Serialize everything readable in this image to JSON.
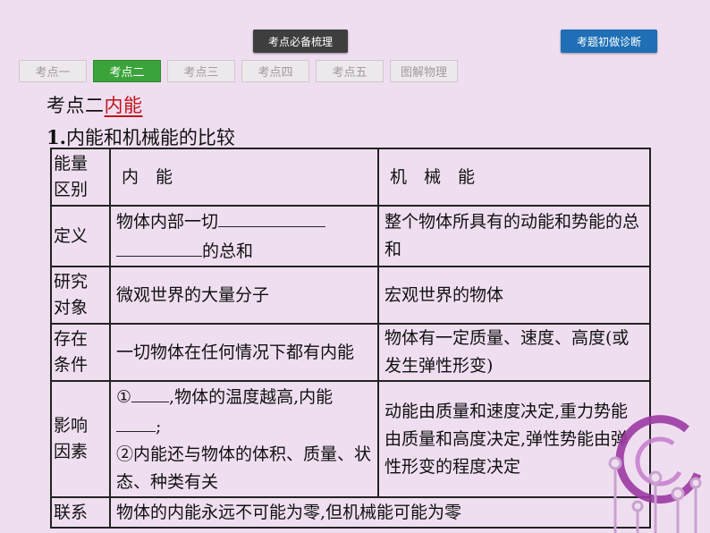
{
  "header": {
    "center_tab_label": "考点必备梳理",
    "diagnose_button_label": "考题初做诊断"
  },
  "tabs": [
    {
      "label": "考点一",
      "active": false
    },
    {
      "label": "考点二",
      "active": true
    },
    {
      "label": "考点三",
      "active": false
    },
    {
      "label": "考点四",
      "active": false
    },
    {
      "label": "考点五",
      "active": false
    },
    {
      "label": "图解物理",
      "active": false
    }
  ],
  "heading": {
    "prefix": "考点二",
    "highlight": "内能"
  },
  "subheading": {
    "number": "1.",
    "text": "内能和机械能的比较"
  },
  "table": {
    "header": {
      "label_line1": "能量",
      "label_line2": "区别",
      "col1": "内　能",
      "col2": "机　械　能"
    },
    "rows": {
      "definition": {
        "label": "定义",
        "col1_part1": "物体内部一切",
        "col1_part2": "的总和",
        "col2": "整个物体所具有的动能和势能的总和"
      },
      "research": {
        "label_line1": "研究",
        "label_line2": "对象",
        "col1": "微观世界的大量分子",
        "col2": "宏观世界的物体"
      },
      "condition": {
        "label_line1": "存在",
        "label_line2": "条件",
        "col1": "一切物体在任何情况下都有内能",
        "col2": "物体有一定质量、速度、高度(或发生弹性形变)"
      },
      "factors": {
        "label_line1": "影响",
        "label_line2": "因素",
        "col1_p1a": "①",
        "col1_p1b": ",物体的温度越高,内能",
        "col1_p1c": ";",
        "col1_p2": "②内能还与物体的体积、质量、状态、种类有关",
        "col2": "动能由质量和速度决定,重力势能由质量和高度决定,弹性势能由弹性形变的程度决定"
      },
      "relation": {
        "label": "联系",
        "text": "物体的内能永远不可能为零,但机械能可能为零"
      }
    }
  },
  "colors": {
    "background": "#efdef0",
    "active_tab": "#3aa43a",
    "diagnose_button": "#1e6fb5",
    "highlight_text": "#c0141b",
    "decoration": "#9b3aa3"
  }
}
